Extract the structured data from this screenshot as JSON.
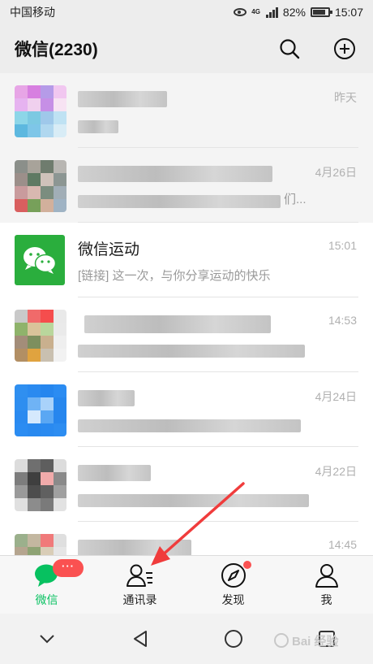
{
  "status_bar": {
    "carrier": "中国移动",
    "network": "4G",
    "battery": "82%",
    "time": "15:07"
  },
  "header": {
    "title": "微信(2230)"
  },
  "chats": [
    {
      "time": "昨天"
    },
    {
      "time": "4月26日",
      "preview_tail": "们..."
    },
    {
      "name": "微信运动",
      "time": "15:01",
      "preview": "[链接] 这一次，与你分享运动的快乐"
    },
    {
      "time": "14:53"
    },
    {
      "time": "4月24日"
    },
    {
      "time": "4月22日"
    },
    {
      "time": "14:45"
    }
  ],
  "tabs": [
    {
      "label": "微信",
      "icon": "chat-bubble-icon",
      "active": true,
      "badge": "···"
    },
    {
      "label": "通讯录",
      "icon": "contacts-icon",
      "active": false
    },
    {
      "label": "发现",
      "icon": "compass-icon",
      "active": false
    },
    {
      "label": "我",
      "icon": "person-icon",
      "active": false
    }
  ],
  "colors": {
    "accent": "#07c160",
    "badge": "#fa5151",
    "sport_avatar": "#2aae3d",
    "arrow": "#f03c3c"
  },
  "watermark": "Bai 经验"
}
